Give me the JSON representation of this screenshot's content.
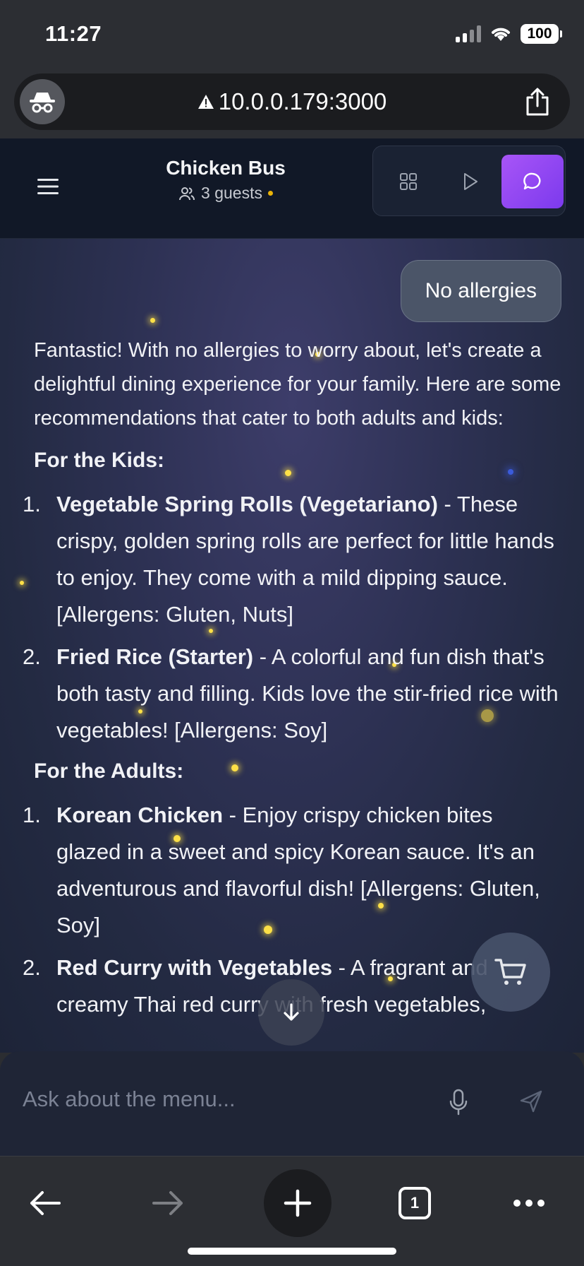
{
  "status_bar": {
    "time": "11:27",
    "battery": "100"
  },
  "browser": {
    "url": "10.0.0.179:3000",
    "tab_count": "1"
  },
  "header": {
    "title": "Chicken Bus",
    "guests": "3 guests"
  },
  "chat": {
    "user_message": "No allergies",
    "intro": "Fantastic! With no allergies to worry about, let's create a delightful dining experience for your family. Here are some recommendations that cater to both adults and kids:",
    "sections": [
      {
        "heading": "For the Kids:",
        "items": [
          {
            "num": "1.",
            "name": "Vegetable Spring Rolls (Vegetariano)",
            "desc": " - These crispy, golden spring rolls are perfect for little hands to enjoy. They come with a mild dipping sauce. [Allergens: Gluten, Nuts]"
          },
          {
            "num": "2.",
            "name": "Fried Rice (Starter)",
            "desc": " - A colorful and fun dish that's both tasty and filling. Kids love the stir-fried rice with vegetables! [Allergens: Soy]"
          }
        ]
      },
      {
        "heading": "For the Adults:",
        "items": [
          {
            "num": "1.",
            "name": "Korean Chicken",
            "desc": " - Enjoy crispy chicken bites glazed in a sweet and spicy Korean sauce. It's an adventurous and flavorful dish! [Allergens: Gluten, Soy]"
          },
          {
            "num": "2.",
            "name": "Red Curry with Vegetables",
            "desc": " - A fragrant and creamy Thai red curry with fresh vegetables,"
          }
        ]
      }
    ]
  },
  "input": {
    "placeholder": "Ask about the menu..."
  },
  "colors": {
    "accent": "#8b5cf6",
    "header_bg": "#111827",
    "status_dot": "#eab308"
  }
}
